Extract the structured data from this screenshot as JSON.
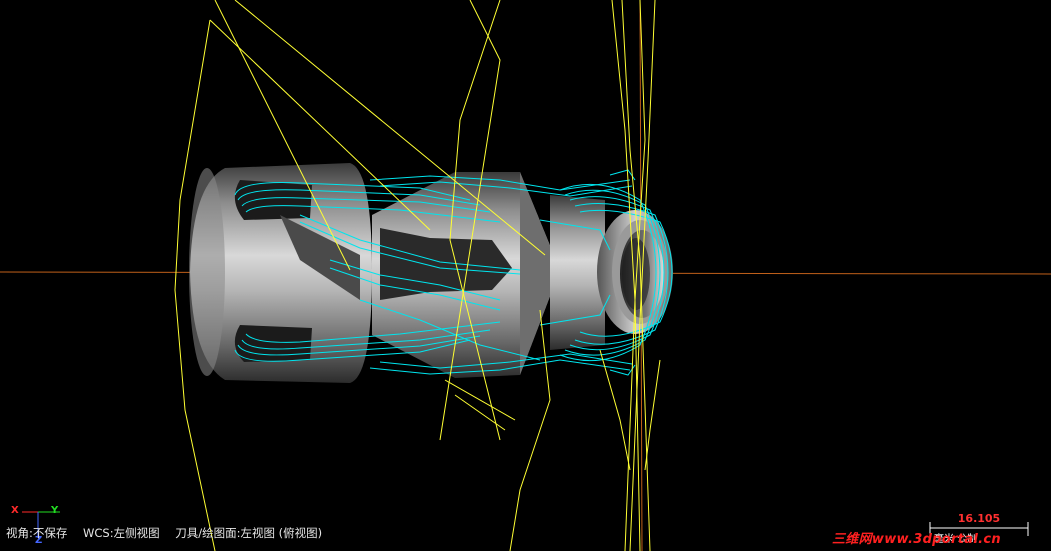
{
  "status": {
    "view": "视角:不保存",
    "wcs": "WCS:左侧视图",
    "tool_plane": "刀具/绘图面:左视图 (俯视图)"
  },
  "axes": {
    "x_label": "X",
    "y_label": "Y",
    "z_label": "Z",
    "x_color": "#ff2a2a",
    "y_color": "#22dd22",
    "z_color": "#4466ff"
  },
  "scale": {
    "value": "16.105",
    "unit": "毫米 公制"
  },
  "watermark": {
    "text": "三维网www.3dportal.cn"
  },
  "colors": {
    "background": "#000000",
    "toolpath_cyan": "#00e5ee",
    "rapid_yellow": "#ffff33",
    "axis_line_orange": "#c0601a",
    "part_gray": "#9a9a9a"
  }
}
